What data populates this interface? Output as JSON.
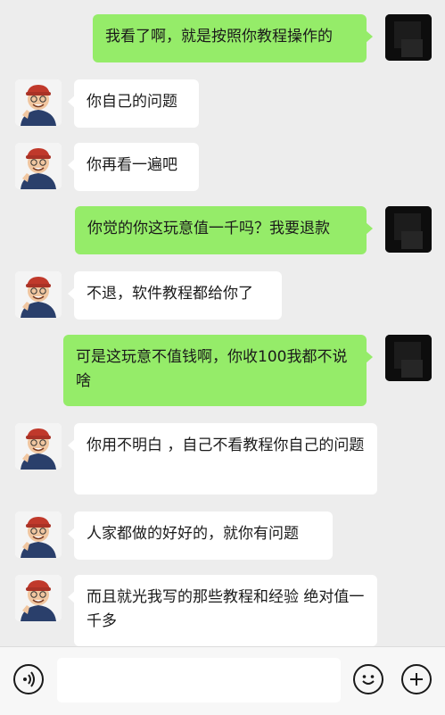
{
  "colors": {
    "background": "#ededed",
    "sent_bubble": "#95ec69",
    "received_bubble": "#ffffff",
    "input_bar": "#f7f7f7"
  },
  "messages": [
    {
      "side": "right",
      "text": "我看了啊，就是按照你教程操作的"
    },
    {
      "side": "left",
      "text": "你自己的问题"
    },
    {
      "side": "left",
      "text": "你再看一遍吧"
    },
    {
      "side": "right",
      "text": "你觉的你这玩意值一千吗？我要退款"
    },
    {
      "side": "left",
      "text": "不退，软件教程都给你了"
    },
    {
      "side": "right",
      "text": "可是这玩意不值钱啊，你收100我都不说啥"
    },
    {
      "side": "left",
      "text": "你用不明白 ，自己不看教程你自己的问题"
    },
    {
      "side": "left",
      "text": "人家都做的好好的，就你有问题"
    },
    {
      "side": "left",
      "text": "而且就光我写的那些教程和经验 绝对值一千多"
    }
  ],
  "input_bar": {
    "voice_icon": "voice-icon",
    "emoji_icon": "emoji-icon",
    "plus_icon": "plus-icon",
    "input_value": ""
  }
}
